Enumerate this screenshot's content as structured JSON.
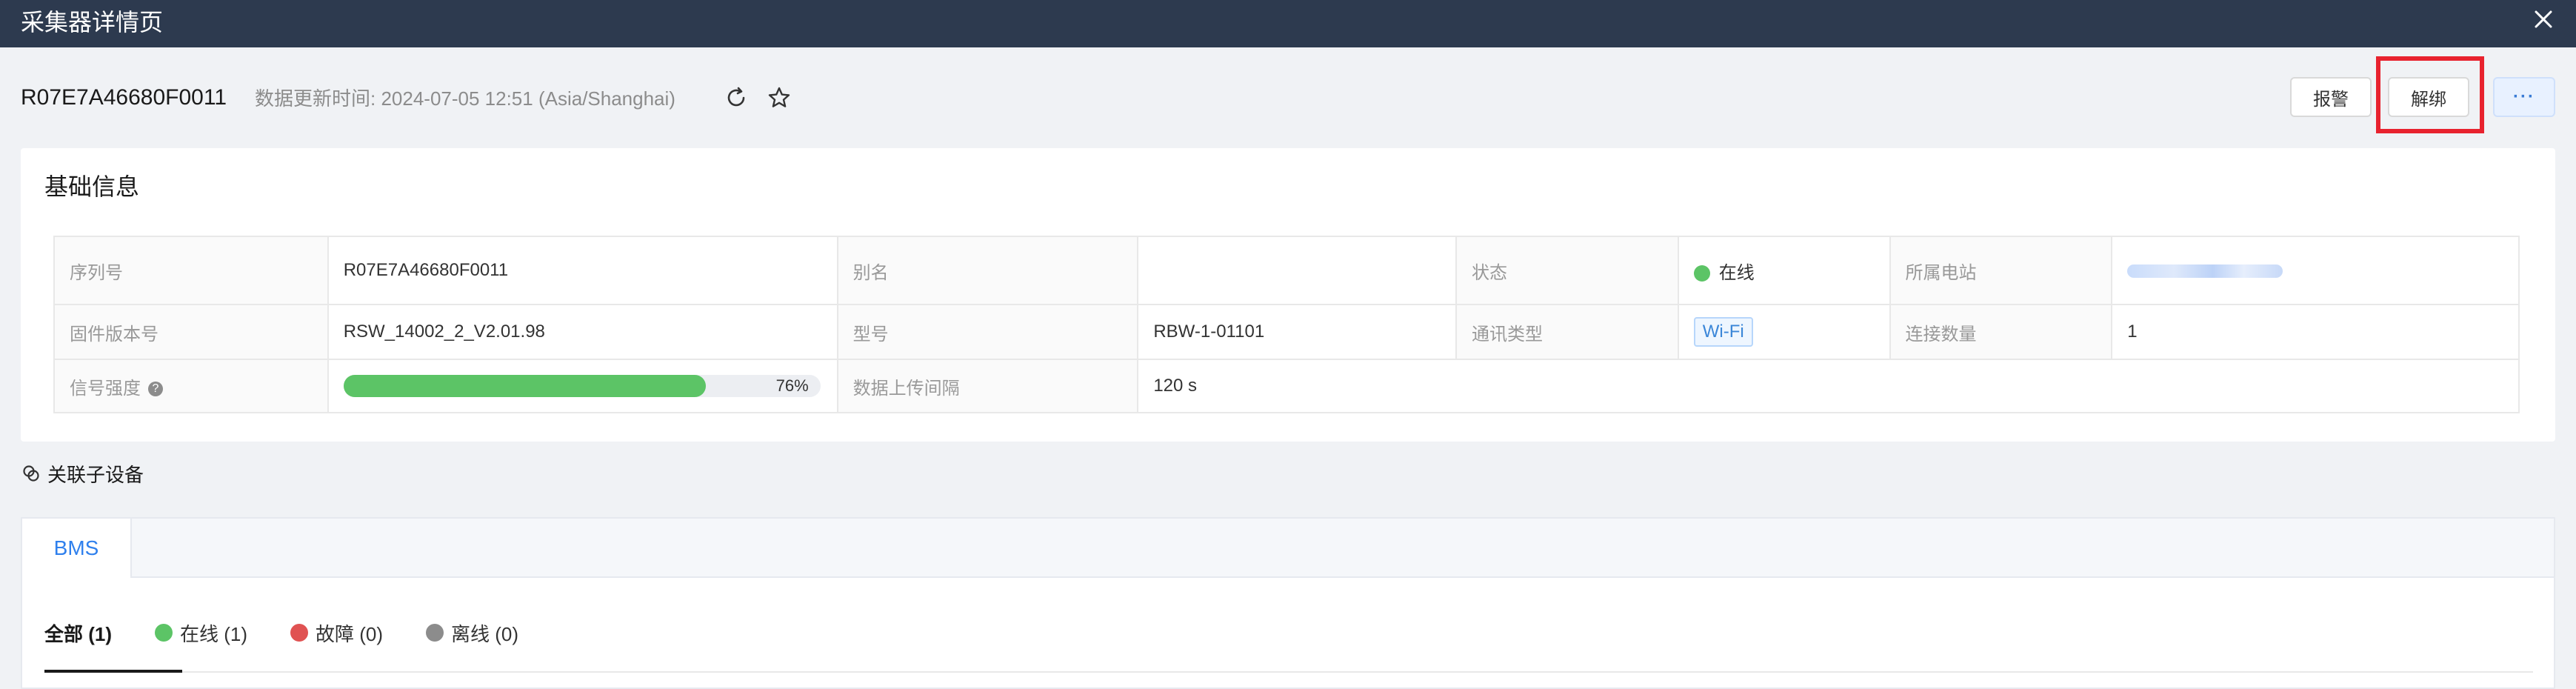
{
  "window": {
    "title": "采集器详情页"
  },
  "header": {
    "device_id": "R07E7A46680F0011",
    "update_time": "数据更新时间: 2024-07-05 12:51 (Asia/Shanghai)",
    "buttons": {
      "alarm": "报警",
      "unbind": "解绑",
      "more": "···"
    }
  },
  "basic": {
    "title": "基础信息",
    "serial_label": "序列号",
    "serial_value": "R07E7A46680F0011",
    "alias_label": "别名",
    "alias_value": "",
    "status_label": "状态",
    "status_value": "在线",
    "station_label": "所属电站",
    "firmware_label": "固件版本号",
    "firmware_value": "RSW_14002_2_V2.01.98",
    "model_label": "型号",
    "model_value": "RBW-1-01101",
    "comm_label": "通讯类型",
    "comm_value": "Wi-Fi",
    "conn_label": "连接数量",
    "conn_value": "1",
    "signal_label": "信号强度",
    "signal_help": "?",
    "signal_percent": 76,
    "signal_text": "76%",
    "upload_label": "数据上传间隔",
    "upload_value": "120 s"
  },
  "sub": {
    "title": "关联子设备",
    "tab": "BMS",
    "filters": {
      "all": "全部 (1)",
      "online": "在线 (1)",
      "fault": "故障 (0)",
      "offline": "离线 (0)"
    }
  },
  "colors": {
    "titlebar": "#2d3a4f",
    "online": "#5cc466",
    "fault": "#e05252",
    "offline": "#8c8c8c",
    "highlight": "#e8222e",
    "accent": "#2f80ed"
  }
}
